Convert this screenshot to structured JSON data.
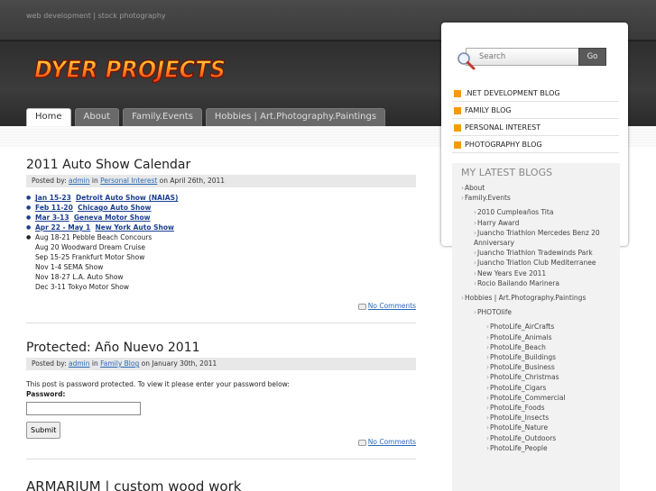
{
  "header": {
    "tagline": "web development | stock photography",
    "logo_text": "DYER PROJECTS",
    "tabs": [
      "Home",
      "About",
      "Family.Events",
      "Hobbies | Art.Photography.Paintings"
    ]
  },
  "search": {
    "placeholder": "Search",
    "button": "Go"
  },
  "categories": [
    ".NET DEVELOPMENT BLOG",
    "FAMILY BLOG",
    "PERSONAL INTEREST",
    "PHOTOGRAPHY BLOG"
  ],
  "colors": {
    "category_bullet": "#f39a12",
    "link": "#2a6ab5",
    "event_link": "#1a3e8f"
  },
  "posts": [
    {
      "title": "2011 Auto Show Calendar",
      "meta_prefix": "Posted by: ",
      "author": "admin",
      "meta_in": " in ",
      "category": "Personal Interest",
      "meta_date": " on April 26th, 2011",
      "events_linked": [
        {
          "date": "Jan 15-23",
          "name": "Detroit Auto Show (NAIAS)"
        },
        {
          "date": "Feb 11-20",
          "name": "Chicago Auto Show"
        },
        {
          "date": "Mar 3-13",
          "name": "Geneva Motor Show"
        },
        {
          "date": "Apr 22 - May 1",
          "name": "New York Auto Show"
        }
      ],
      "events_plain": [
        "Aug 18-21 Pebble Beach Concours",
        "Aug 20 Woodward Dream Cruise",
        "Sep 15-25 Frankfurt Motor Show",
        "Nov 1-4 SEMA Show",
        "Nov 18-27 L.A. Auto Show",
        "Dec 3-11 Tokyo Motor Show"
      ],
      "comments": "No Comments"
    },
    {
      "title": "Protected: Año Nuevo 2011",
      "meta_prefix": "Posted by: ",
      "author": "admin",
      "meta_in": " in ",
      "category": "Family Blog",
      "meta_date": " on January 30th, 2011",
      "protected_text": "This post is password protected. To view it please enter your password below:",
      "password_label": "Password:",
      "submit": "Submit",
      "comments": "No Comments"
    },
    {
      "title": "ARMARIUM | custom wood work"
    }
  ],
  "latest": {
    "title": "MY LATEST BLOGS",
    "items": [
      {
        "text": "About",
        "level": 0
      },
      {
        "text": "Family.Events",
        "level": 0
      },
      {
        "text": "2010 Cumpleaños Tita",
        "level": 1
      },
      {
        "text": "Harry Award",
        "level": 1
      },
      {
        "text": "Juancho Triathlon Mercedes Benz 20 Anniversary",
        "level": 1
      },
      {
        "text": "Juancho Triathlon Tradewinds Park",
        "level": 1
      },
      {
        "text": "Juancho Triatlon Club Mediterranee",
        "level": 1
      },
      {
        "text": "New Years Eve 2011",
        "level": 1
      },
      {
        "text": "Rocio Bailando Marinera",
        "level": 1
      },
      {
        "text": "Hobbies | Art.Photography.Paintings",
        "level": 0
      },
      {
        "text": "PHOTOlife",
        "level": 1
      },
      {
        "text": "PhotoLife_AirCrafts",
        "level": 2
      },
      {
        "text": "PhotoLife_Animals",
        "level": 2
      },
      {
        "text": "PhotoLife_Beach",
        "level": 2
      },
      {
        "text": "PhotoLife_Buildings",
        "level": 2
      },
      {
        "text": "PhotoLife_Business",
        "level": 2
      },
      {
        "text": "PhotoLife_Christmas",
        "level": 2
      },
      {
        "text": "PhotoLife_Cigars",
        "level": 2
      },
      {
        "text": "PhotoLife_Commercial",
        "level": 2
      },
      {
        "text": "PhotoLife_Foods",
        "level": 2
      },
      {
        "text": "PhotoLife_Insects",
        "level": 2
      },
      {
        "text": "PhotoLife_Nature",
        "level": 2
      },
      {
        "text": "PhotoLife_Outdoors",
        "level": 2
      },
      {
        "text": "PhotoLife_People",
        "level": 2
      }
    ]
  }
}
